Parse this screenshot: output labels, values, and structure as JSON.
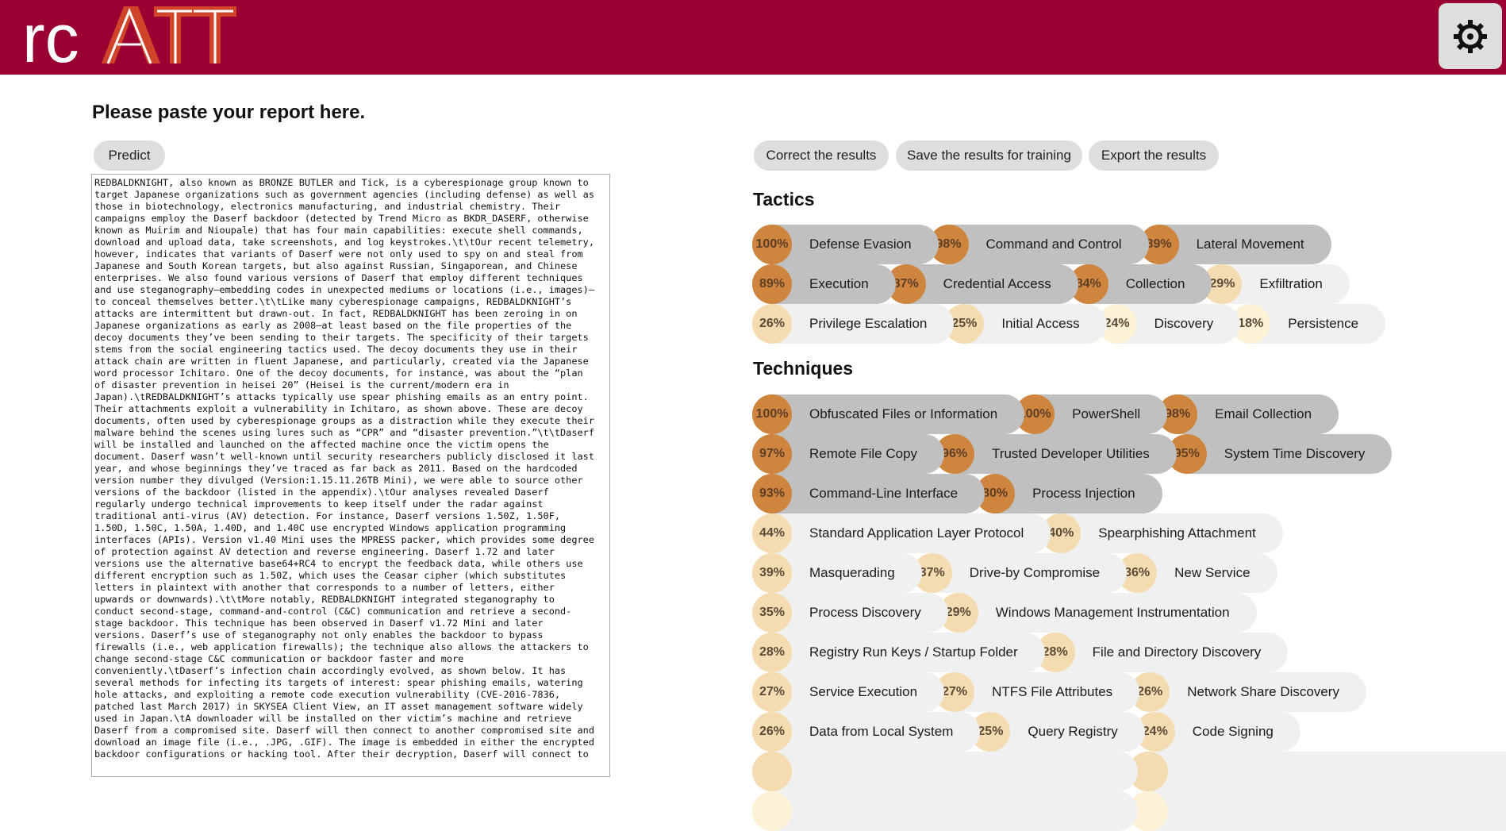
{
  "header": {
    "logo_text": {
      "prefix": "rc",
      "suffix": "ATT"
    },
    "settings_icon": "gear-icon",
    "colors": {
      "bar": "#9b0033",
      "logo_accent": "#d0452a"
    }
  },
  "page": {
    "title": "Please paste your report here.",
    "predict_label": "Predict"
  },
  "report": {
    "text": "REDBALDKNIGHT, also known as BRONZE BUTLER and Tick, is a cyberespionage group known to\ntarget Japanese organizations such as government agencies (including defense) as well as\nthose in biotechnology, electronics manufacturing, and industrial chemistry. Their\ncampaigns employ the Daserf backdoor (detected by Trend Micro as BKDR_DASERF, otherwise\nknown as Muirim and Nioupale) that has four main capabilities: execute shell commands,\ndownload and upload data, take screenshots, and log keystrokes.\\t\\tOur recent telemetry,\nhowever, indicates that variants of Daserf were not only used to spy on and steal from\nJapanese and South Korean targets, but also against Russian, Singaporean, and Chinese\nenterprises. We also found various versions of Daserf that employ different techniques\nand use steganography—embedding codes in unexpected mediums or locations (i.e., images)—\nto conceal themselves better.\\t\\tLike many cyberespionage campaigns, REDBALDKNIGHT’s\nattacks are intermittent but drawn-out. In fact, REDBALDKNIGHT has been zeroing in on\nJapanese organizations as early as 2008—at least based on the file properties of the\ndecoy documents they’ve been sending to their targets. The specificity of their targets\nstems from the social engineering tactics used. The decoy documents they use in their\nattack chain are written in fluent Japanese, and particularly, created via the Japanese\nword processor Ichitaro. One of the decoy documents, for instance, was about the “plan\nof disaster prevention in heisei 20” (Heisei is the current/modern era in\nJapan).\\tREDBALDKNIGHT’s attacks typically use spear phishing emails as an entry point.\nTheir attachments exploit a vulnerability in Ichitaro, as shown above. These are decoy\ndocuments, often used by cyberespionage groups as a distraction while they execute their\nmalware behind the scenes using lures such as “CPR” and “disaster prevention.”\\t\\tDaserf\nwill be installed and launched on the affected machine once the victim opens the\ndocument. Daserf wasn’t well-known until security researchers publicly disclosed it last\nyear, and whose beginnings they’ve traced as far back as 2011. Based on the hardcoded\nversion number they divulged (Version:1.15.11.26TB Mini), we were able to source other\nversions of the backdoor (listed in the appendix).\\tOur analyses revealed Daserf\nregularly undergo technical improvements to keep itself under the radar against\ntraditional anti-virus (AV) detection. For instance, Daserf versions 1.50Z, 1.50F,\n1.50D, 1.50C, 1.50A, 1.40D, and 1.40C use encrypted Windows application programming\ninterfaces (APIs). Version v1.40 Mini uses the MPRESS packer, which provides some degree\nof protection against AV detection and reverse engineering. Daserf 1.72 and later\nversions use the alternative base64+RC4 to encrypt the feedback data, while others use\ndifferent encryption such as 1.50Z, which uses the Ceasar cipher (which substitutes\nletters in plaintext with another that corresponds to a number of letters, either\nupwards or downwards).\\t\\tMore notably, REDBALDKNIGHT integrated steganography to\nconduct second-stage, command-and-control (C&C) communication and retrieve a second-\nstage backdoor. This technique has been observed in Daserf v1.72 Mini and later\nversions. Daserf’s use of steganography not only enables the backdoor to bypass\nfirewalls (i.e., web application firewalls); the technique also allows the attackers to\nchange second-stage C&C communication or backdoor faster and more\nconveniently.\\tDaserf’s infection chain accordingly evolved, as shown below. It has\nseveral methods for infecting its targets of interest: spear phishing emails, watering\nhole attacks, and exploiting a remote code execution vulnerability (CVE-2016-7836,\npatched last March 2017) in SKYSEA Client View, an IT asset management software widely\nused in Japan.\\tA downloader will be installed on ther victim’s machine and retrieve\nDaserf from a compromised site. Daserf will then connect to another compromised site and\ndownload an image file (i.e., .JPG, .GIF). The image is embedded in either the encrypted\nbackdoor configurations or hacking tool. After their decryption, Daserf will connect to"
  },
  "results": {
    "buttons": {
      "correct": "Correct the results",
      "save": "Save the results for training",
      "export": "Export the results"
    },
    "tactics_title": "Tactics",
    "techniques_title": "Techniques",
    "colors": {
      "high_circle": "#cf853e",
      "high_pill": "#c0c0c0",
      "mid_circle": "#f4dcb0",
      "low_circle": "#fdf2d6",
      "light_pill": "#f0f0f0"
    },
    "tactics_rows": [
      [
        {
          "pct": "100%",
          "value": 100,
          "tier": "high",
          "label": "Defense Evasion"
        },
        {
          "pct": "98%",
          "value": 98,
          "tier": "high",
          "label": "Command and Control"
        },
        {
          "pct": "89%",
          "value": 89,
          "tier": "high",
          "label": "Lateral Movement"
        }
      ],
      [
        {
          "pct": "89%",
          "value": 89,
          "tier": "high",
          "label": "Execution"
        },
        {
          "pct": "87%",
          "value": 87,
          "tier": "high",
          "label": "Credential Access"
        },
        {
          "pct": "84%",
          "value": 84,
          "tier": "high",
          "label": "Collection"
        },
        {
          "pct": "29%",
          "value": 29,
          "tier": "mid",
          "label": "Exfiltration"
        }
      ],
      [
        {
          "pct": "26%",
          "value": 26,
          "tier": "mid",
          "label": "Privilege Escalation"
        },
        {
          "pct": "25%",
          "value": 25,
          "tier": "mid",
          "label": "Initial Access"
        },
        {
          "pct": "24%",
          "value": 24,
          "tier": "low",
          "label": "Discovery"
        },
        {
          "pct": "18%",
          "value": 18,
          "tier": "low",
          "label": "Persistence"
        }
      ]
    ],
    "techniques_rows": [
      [
        {
          "pct": "100%",
          "value": 100,
          "tier": "high",
          "label": "Obfuscated Files or Information"
        },
        {
          "pct": "100%",
          "value": 100,
          "tier": "high",
          "label": "PowerShell"
        },
        {
          "pct": "98%",
          "value": 98,
          "tier": "high",
          "label": "Email Collection"
        }
      ],
      [
        {
          "pct": "97%",
          "value": 97,
          "tier": "high",
          "label": "Remote File Copy"
        },
        {
          "pct": "96%",
          "value": 96,
          "tier": "high",
          "label": "Trusted Developer Utilities"
        },
        {
          "pct": "95%",
          "value": 95,
          "tier": "high",
          "label": "System Time Discovery"
        }
      ],
      [
        {
          "pct": "93%",
          "value": 93,
          "tier": "high",
          "label": "Command-Line Interface"
        },
        {
          "pct": "80%",
          "value": 80,
          "tier": "high",
          "label": "Process Injection"
        }
      ],
      [
        {
          "pct": "44%",
          "value": 44,
          "tier": "mid",
          "label": "Standard Application Layer Protocol"
        },
        {
          "pct": "40%",
          "value": 40,
          "tier": "mid",
          "label": "Spearphishing Attachment"
        }
      ],
      [
        {
          "pct": "39%",
          "value": 39,
          "tier": "mid",
          "label": "Masquerading"
        },
        {
          "pct": "37%",
          "value": 37,
          "tier": "mid",
          "label": "Drive-by Compromise"
        },
        {
          "pct": "36%",
          "value": 36,
          "tier": "mid",
          "label": "New Service"
        }
      ],
      [
        {
          "pct": "35%",
          "value": 35,
          "tier": "mid",
          "label": "Process Discovery"
        },
        {
          "pct": "29%",
          "value": 29,
          "tier": "mid",
          "label": "Windows Management Instrumentation"
        }
      ],
      [
        {
          "pct": "28%",
          "value": 28,
          "tier": "mid",
          "label": "Registry Run Keys / Startup Folder"
        },
        {
          "pct": "28%",
          "value": 28,
          "tier": "mid",
          "label": "File and Directory Discovery"
        }
      ],
      [
        {
          "pct": "27%",
          "value": 27,
          "tier": "mid",
          "label": "Service Execution"
        },
        {
          "pct": "27%",
          "value": 27,
          "tier": "mid",
          "label": "NTFS File Attributes"
        },
        {
          "pct": "26%",
          "value": 26,
          "tier": "mid",
          "label": "Network Share Discovery"
        }
      ],
      [
        {
          "pct": "26%",
          "value": 26,
          "tier": "mid",
          "label": "Data from Local System"
        },
        {
          "pct": "25%",
          "value": 25,
          "tier": "mid",
          "label": "Query Registry"
        },
        {
          "pct": "24%",
          "value": 24,
          "tier": "mid",
          "label": "Code Signing"
        }
      ],
      [
        {
          "pct": "",
          "value": null,
          "tier": "mid",
          "label": ""
        },
        {
          "pct": "",
          "value": null,
          "tier": "mid",
          "label": ""
        },
        {
          "pct": "",
          "value": null,
          "tier": "mid",
          "label": ""
        }
      ],
      [
        {
          "pct": "",
          "value": null,
          "tier": "low",
          "label": ""
        },
        {
          "pct": "",
          "value": null,
          "tier": "low",
          "label": ""
        },
        {
          "pct": "",
          "value": null,
          "tier": "low",
          "label": ""
        }
      ]
    ]
  }
}
